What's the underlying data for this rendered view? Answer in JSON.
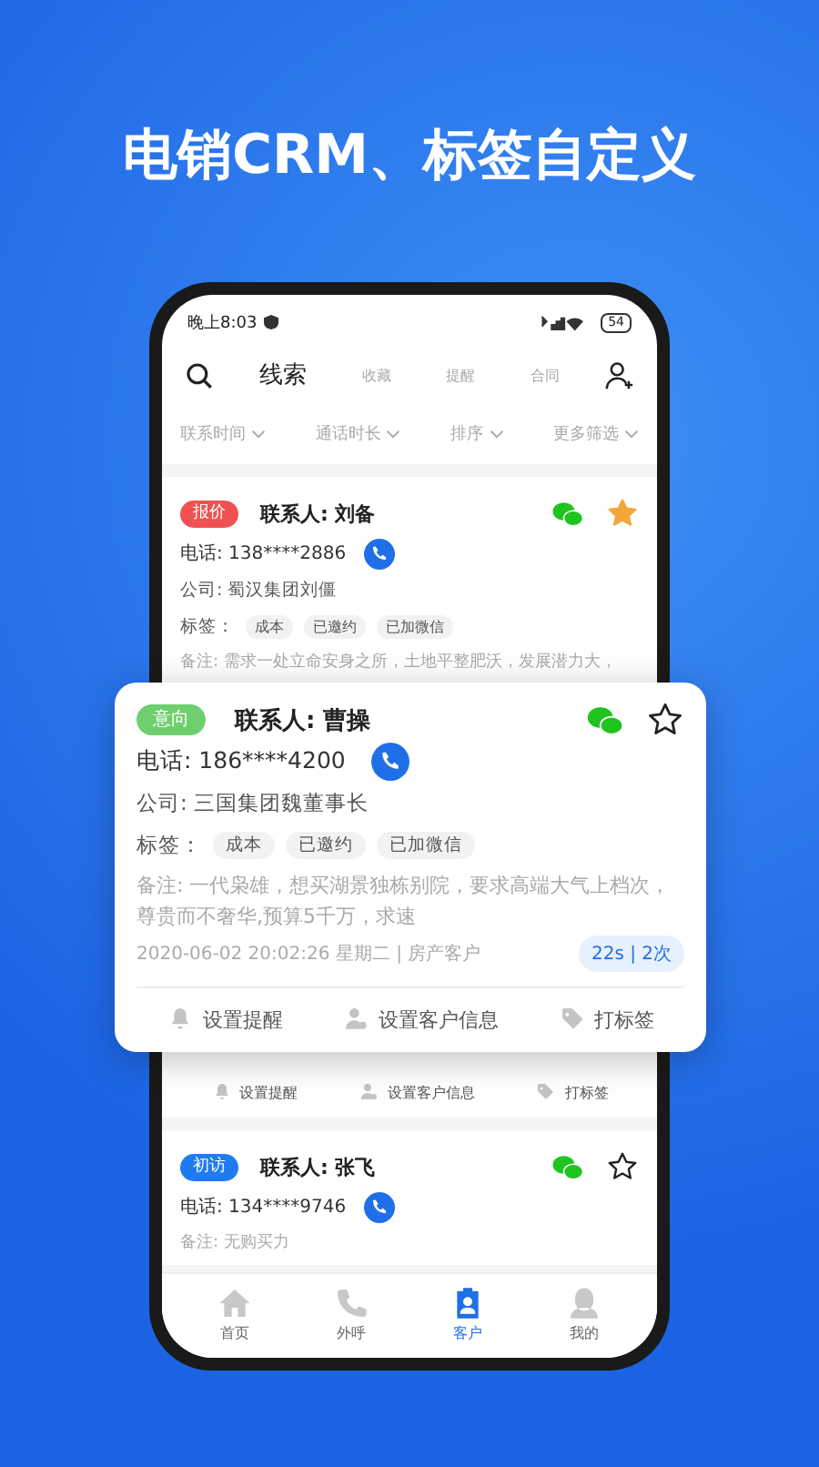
{
  "headline": "电销CRM、标签自定义",
  "status_bar": {
    "time": "晚上8:03",
    "battery": "54"
  },
  "tabs": [
    {
      "label": "线索",
      "selected": true
    },
    {
      "label": "收藏",
      "selected": false
    },
    {
      "label": "提醒",
      "selected": false
    },
    {
      "label": "合同",
      "selected": false
    }
  ],
  "filters": [
    "联系时间",
    "通话时长",
    "排序",
    "更多筛选"
  ],
  "cards": [
    {
      "stage": "报价",
      "color": "#f05252",
      "contact": "联系人: 刘备",
      "phone": "电话: 138****2886",
      "company": "公司: 蜀汉集团刘僵",
      "tags_label": "标签：",
      "tags": [
        "成本",
        "已邀约",
        "已加微信"
      ],
      "remark": "备注: 需求一处立命安身之所，土地平整肥沃，发展潜力大，",
      "starred": true,
      "actions": [
        {
          "label": "设置提醒",
          "kind": "bell"
        },
        {
          "label": "设置客户信息",
          "kind": "user"
        },
        {
          "label": "打标签",
          "kind": "tag"
        }
      ]
    },
    {
      "stage": "初访",
      "color": "#1f7cf0",
      "contact": "联系人: 张飞",
      "phone": "电话: 134****9746",
      "remark": "备注: 无购买力",
      "starred": false
    }
  ],
  "popup_card": {
    "stage": "意向",
    "color": "#6fcf6f",
    "contact": "联系人: 曹操",
    "phone": "电话: 186****4200",
    "company": "公司: 三国集团魏董事长",
    "tags_label": "标签：",
    "tags": [
      "成本",
      "已邀约",
      "已加微信"
    ],
    "remark": "备注: 一代枭雄，想买湖景独栋别院，要求高端大气上档次，尊贵而不奢华,预算5千万，求速",
    "meta": "2020-06-02 20:02:26 星期二 | 房产客户",
    "stats": "22s | 2次",
    "starred": false,
    "actions": [
      {
        "label": "设置提醒",
        "kind": "bell"
      },
      {
        "label": "设置客户信息",
        "kind": "user"
      },
      {
        "label": "打标签",
        "kind": "tag"
      }
    ]
  },
  "bottom_nav": [
    {
      "label": "首页",
      "kind": "home",
      "selected": false
    },
    {
      "label": "外呼",
      "kind": "phone",
      "selected": false
    },
    {
      "label": "客户",
      "kind": "client",
      "selected": true
    },
    {
      "label": "我的",
      "kind": "me",
      "selected": false
    }
  ]
}
